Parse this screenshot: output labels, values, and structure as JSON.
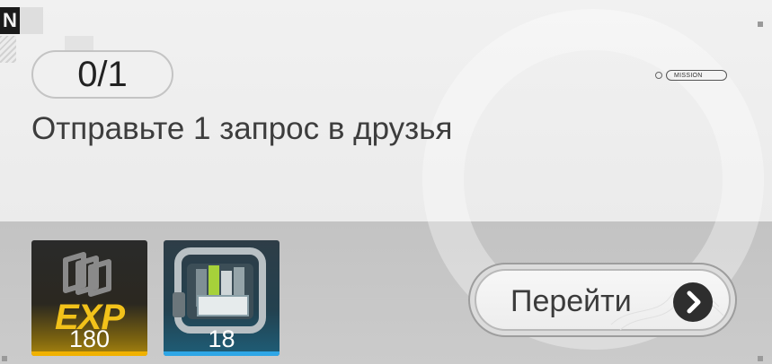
{
  "mission": {
    "progress": "0/1",
    "tag": "MISSION",
    "title": "Отправьте 1 запрос в друзья"
  },
  "corner_badge": "N",
  "rewards": [
    {
      "type": "exp",
      "label": "EXP",
      "count": "180",
      "icon": "exp-chips-icon",
      "rarity_color": "#f0b100"
    },
    {
      "type": "item",
      "count": "18",
      "icon": "supply-crate-icon",
      "rarity_color": "#2ea6e6"
    }
  ],
  "go_button": {
    "label": "Перейти",
    "icon": "chevron-right-icon"
  },
  "colors": {
    "card_top": "#efefef",
    "card_bottom": "#c6c6c6",
    "text_dark": "#3d3d3d"
  }
}
